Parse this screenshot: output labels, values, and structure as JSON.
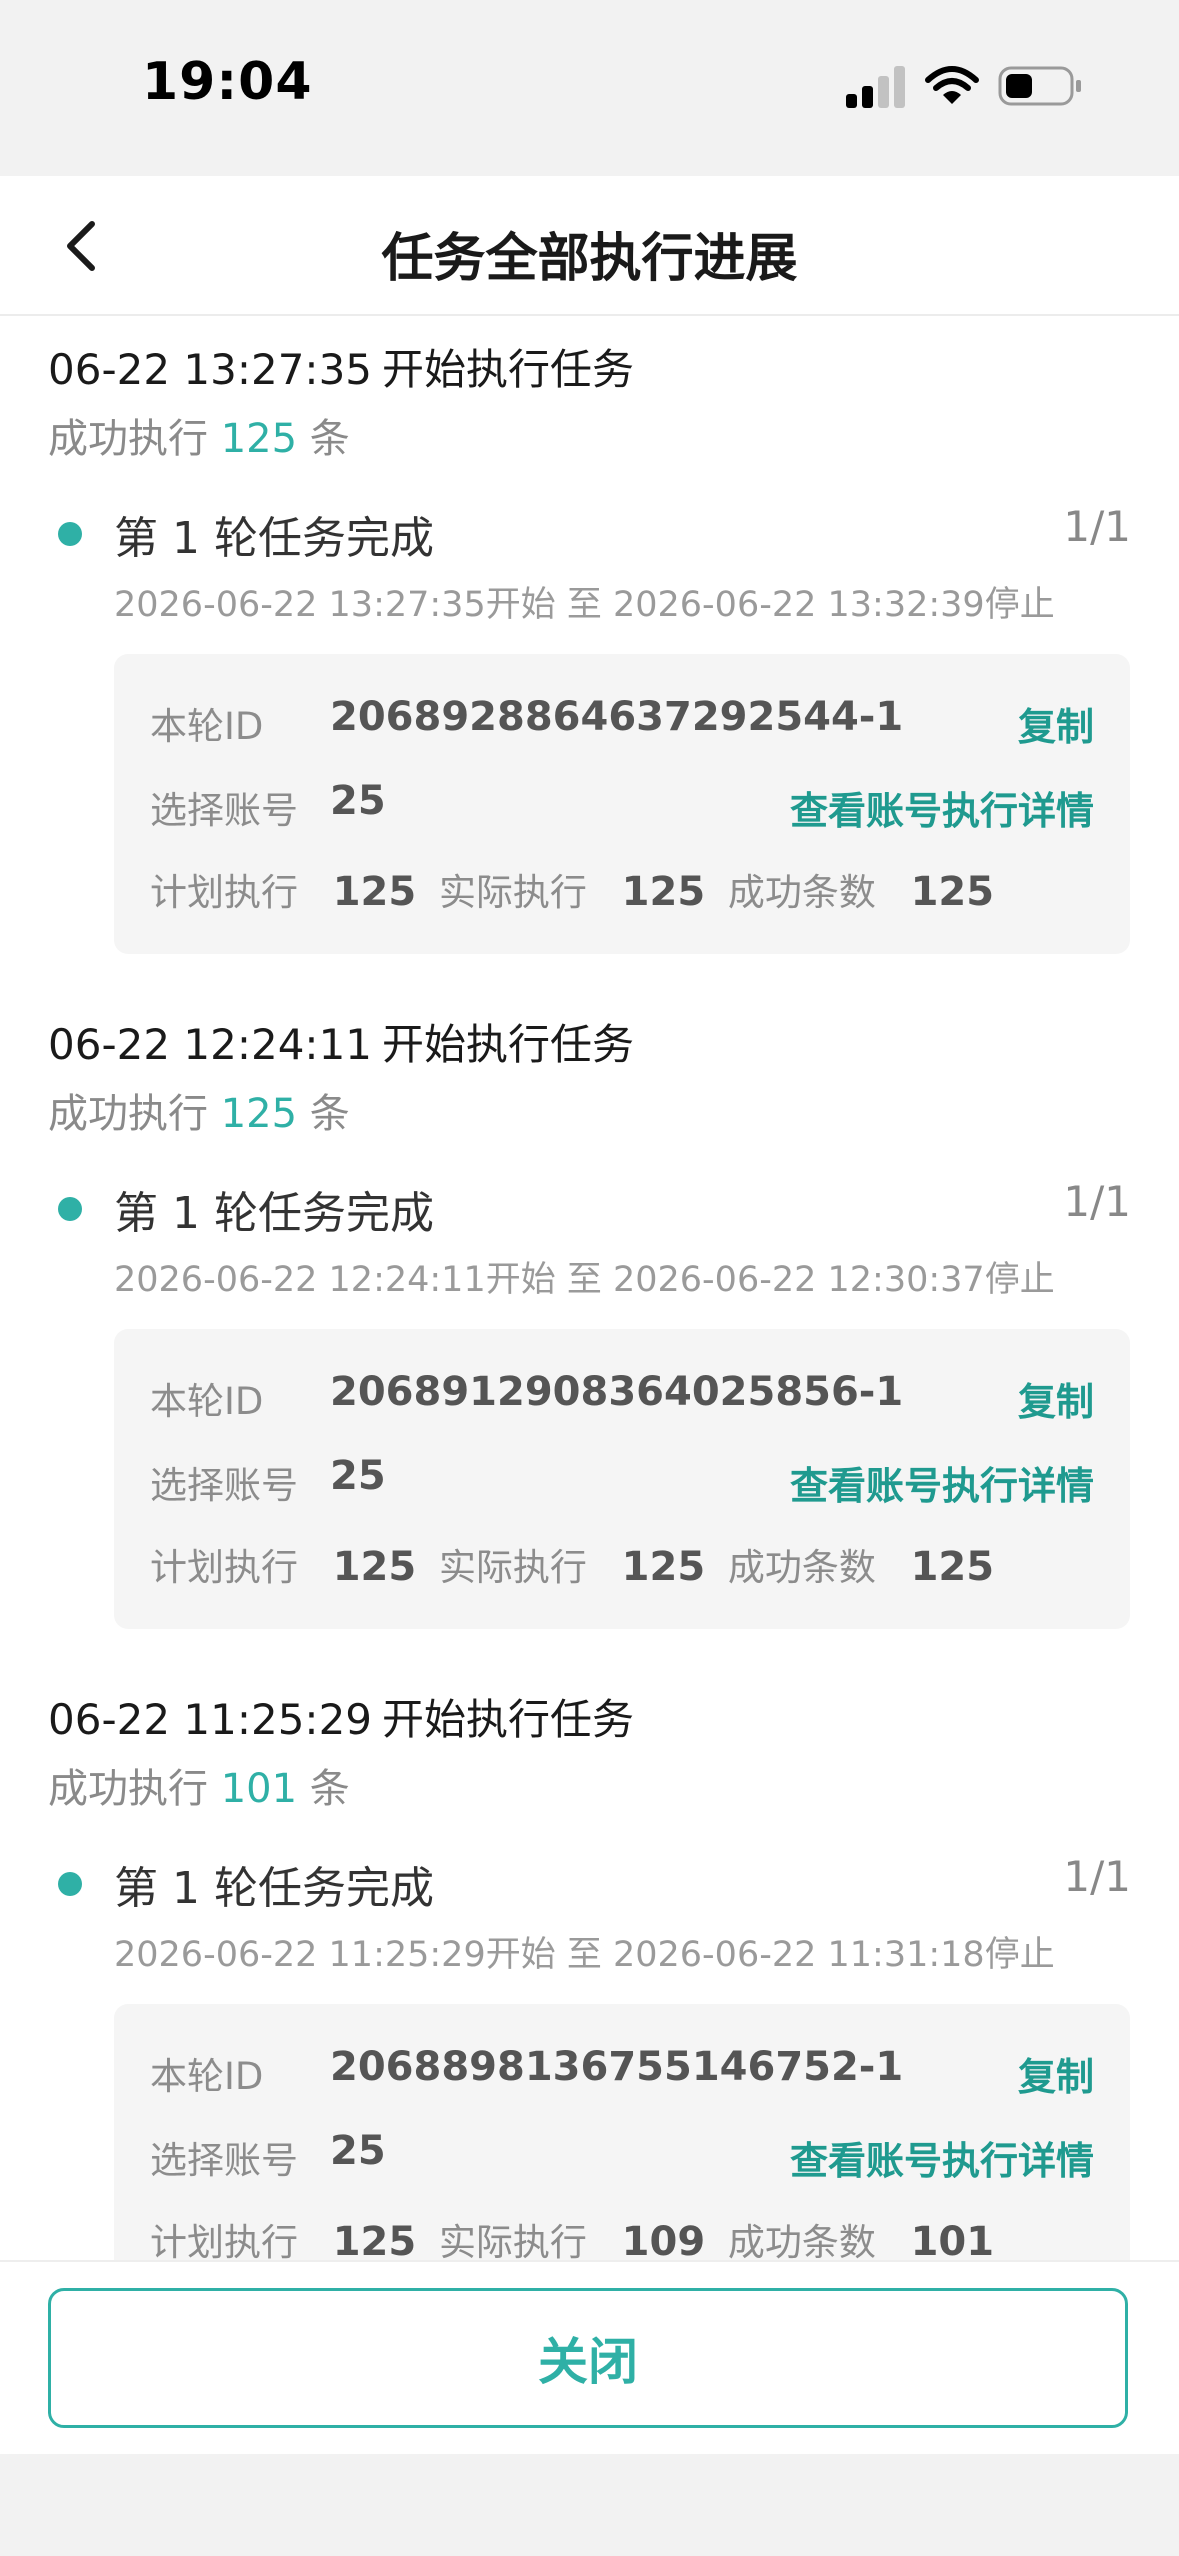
{
  "status_bar": {
    "time": "19:04"
  },
  "header": {
    "title": "任务全部执行进展"
  },
  "tasks": [
    {
      "start_time": "06-22 13:27:35",
      "action": "开始执行任务",
      "summary_prefix": "成功执行",
      "success_count": "125",
      "summary_suffix": "条",
      "round": {
        "title": "第 1 轮任务完成",
        "ratio": "1/1",
        "time_range": "2026-06-22 13:27:35开始 至 2026-06-22 13:32:39停止"
      },
      "detail": {
        "id_label": "本轮ID",
        "id_value": "2068928864637292544-1",
        "copy_label": "复制",
        "account_label": "选择账号",
        "account_value": "25",
        "account_link": "查看账号执行详情",
        "plan_label": "计划执行",
        "plan_value": "125",
        "actual_label": "实际执行",
        "actual_value": "125",
        "success_label": "成功条数",
        "success_value": "125"
      }
    },
    {
      "start_time": "06-22 12:24:11",
      "action": "开始执行任务",
      "summary_prefix": "成功执行",
      "success_count": "125",
      "summary_suffix": "条",
      "round": {
        "title": "第 1 轮任务完成",
        "ratio": "1/1",
        "time_range": "2026-06-22 12:24:11开始 至 2026-06-22 12:30:37停止"
      },
      "detail": {
        "id_label": "本轮ID",
        "id_value": "2068912908364025856-1",
        "copy_label": "复制",
        "account_label": "选择账号",
        "account_value": "25",
        "account_link": "查看账号执行详情",
        "plan_label": "计划执行",
        "plan_value": "125",
        "actual_label": "实际执行",
        "actual_value": "125",
        "success_label": "成功条数",
        "success_value": "125"
      }
    },
    {
      "start_time": "06-22 11:25:29",
      "action": "开始执行任务",
      "summary_prefix": "成功执行",
      "success_count": "101",
      "summary_suffix": "条",
      "round": {
        "title": "第 1 轮任务完成",
        "ratio": "1/1",
        "time_range": "2026-06-22 11:25:29开始 至 2026-06-22 11:31:18停止"
      },
      "detail": {
        "id_label": "本轮ID",
        "id_value": "2068898136755146752-1",
        "copy_label": "复制",
        "account_label": "选择账号",
        "account_value": "25",
        "account_link": "查看账号执行详情",
        "plan_label": "计划执行",
        "plan_value": "125",
        "actual_label": "实际执行",
        "actual_value": "109",
        "success_label": "成功条数",
        "success_value": "101"
      }
    }
  ],
  "footer": {
    "close_label": "关闭"
  },
  "colors": {
    "accent": "#2fb0a6",
    "link": "#1f9a8f",
    "muted": "#8a8a8a"
  }
}
